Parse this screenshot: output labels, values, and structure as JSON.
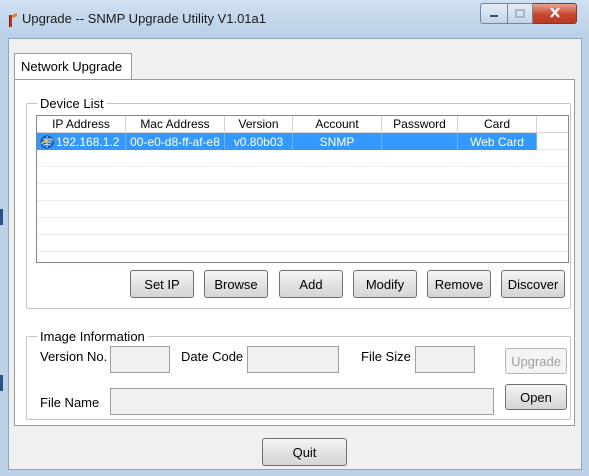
{
  "window": {
    "title": "Upgrade -- SNMP Upgrade Utility V1.01a1",
    "icon": "upgrade-app-icon",
    "controls": {
      "minimize_icon": "minimize-icon",
      "maximize_icon": "maximize-icon",
      "close_icon": "close-icon"
    }
  },
  "tabs": [
    {
      "label": "Network Upgrade",
      "selected": true
    }
  ],
  "device_list": {
    "legend": "Device List",
    "columns": [
      "IP Address",
      "Mac Address",
      "Version",
      "Account",
      "Password",
      "Card"
    ],
    "rows": [
      {
        "ip": "192.168.1.2",
        "mac": "00-e0-d8-ff-af-e8",
        "version": "v0.80b03",
        "account": "SNMP",
        "password": "",
        "card": "Web Card",
        "selected": true,
        "icon": "network-device-icon"
      }
    ],
    "buttons": {
      "set_ip": "Set IP",
      "browse": "Browse",
      "add": "Add",
      "modify": "Modify",
      "remove": "Remove",
      "discover": "Discover"
    }
  },
  "image_information": {
    "legend": "Image Information",
    "version_label": "Version No.",
    "version_value": "",
    "date_code_label": "Date Code",
    "date_code_value": "",
    "file_size_label": "File Size",
    "file_size_value": "",
    "file_name_label": "File Name",
    "file_name_value": "",
    "upgrade_button": "Upgrade",
    "upgrade_enabled": false,
    "open_button": "Open"
  },
  "footer": {
    "quit_button": "Quit"
  },
  "colors": {
    "selection": "#3399ff",
    "close_button": "#c8472e",
    "titlebar": "#cfe0f1"
  }
}
